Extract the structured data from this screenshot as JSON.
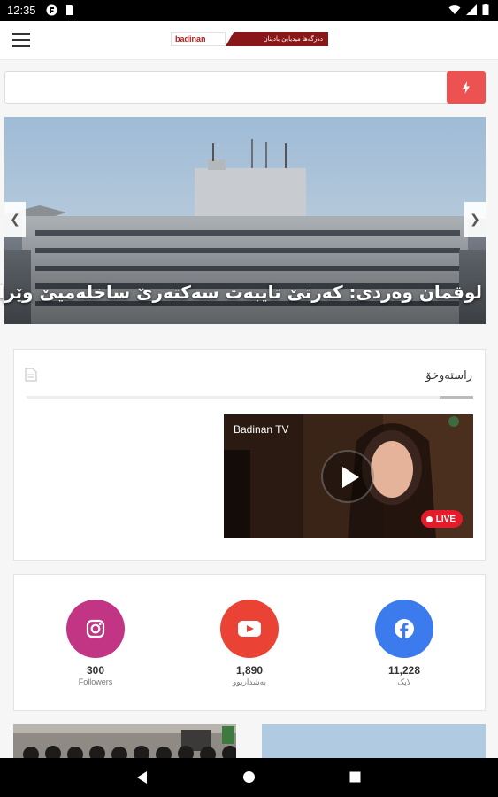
{
  "status_bar": {
    "time": "12:35"
  },
  "header": {
    "logo_text": "badinan",
    "logo_tagline": "دەزگەها میدیایێ بادینان"
  },
  "search": {
    "placeholder": ""
  },
  "slider": {
    "caption": "لوقمان وەردی: کەرتێ تایبەت سەکتەرێ ساخلەمیێ وێرانکر"
  },
  "live_section": {
    "title": "راستەوخۆ",
    "video_label": "Badinan TV",
    "live_badge": "LIVE"
  },
  "social": [
    {
      "name": "instagram",
      "count": "300",
      "label": "Followers",
      "color": "#c13584"
    },
    {
      "name": "youtube",
      "count": "1,890",
      "label": "بەشداربوو",
      "color": "#ea4335"
    },
    {
      "name": "facebook",
      "count": "11,228",
      "label": "لایک",
      "color": "#3b7bee"
    }
  ]
}
